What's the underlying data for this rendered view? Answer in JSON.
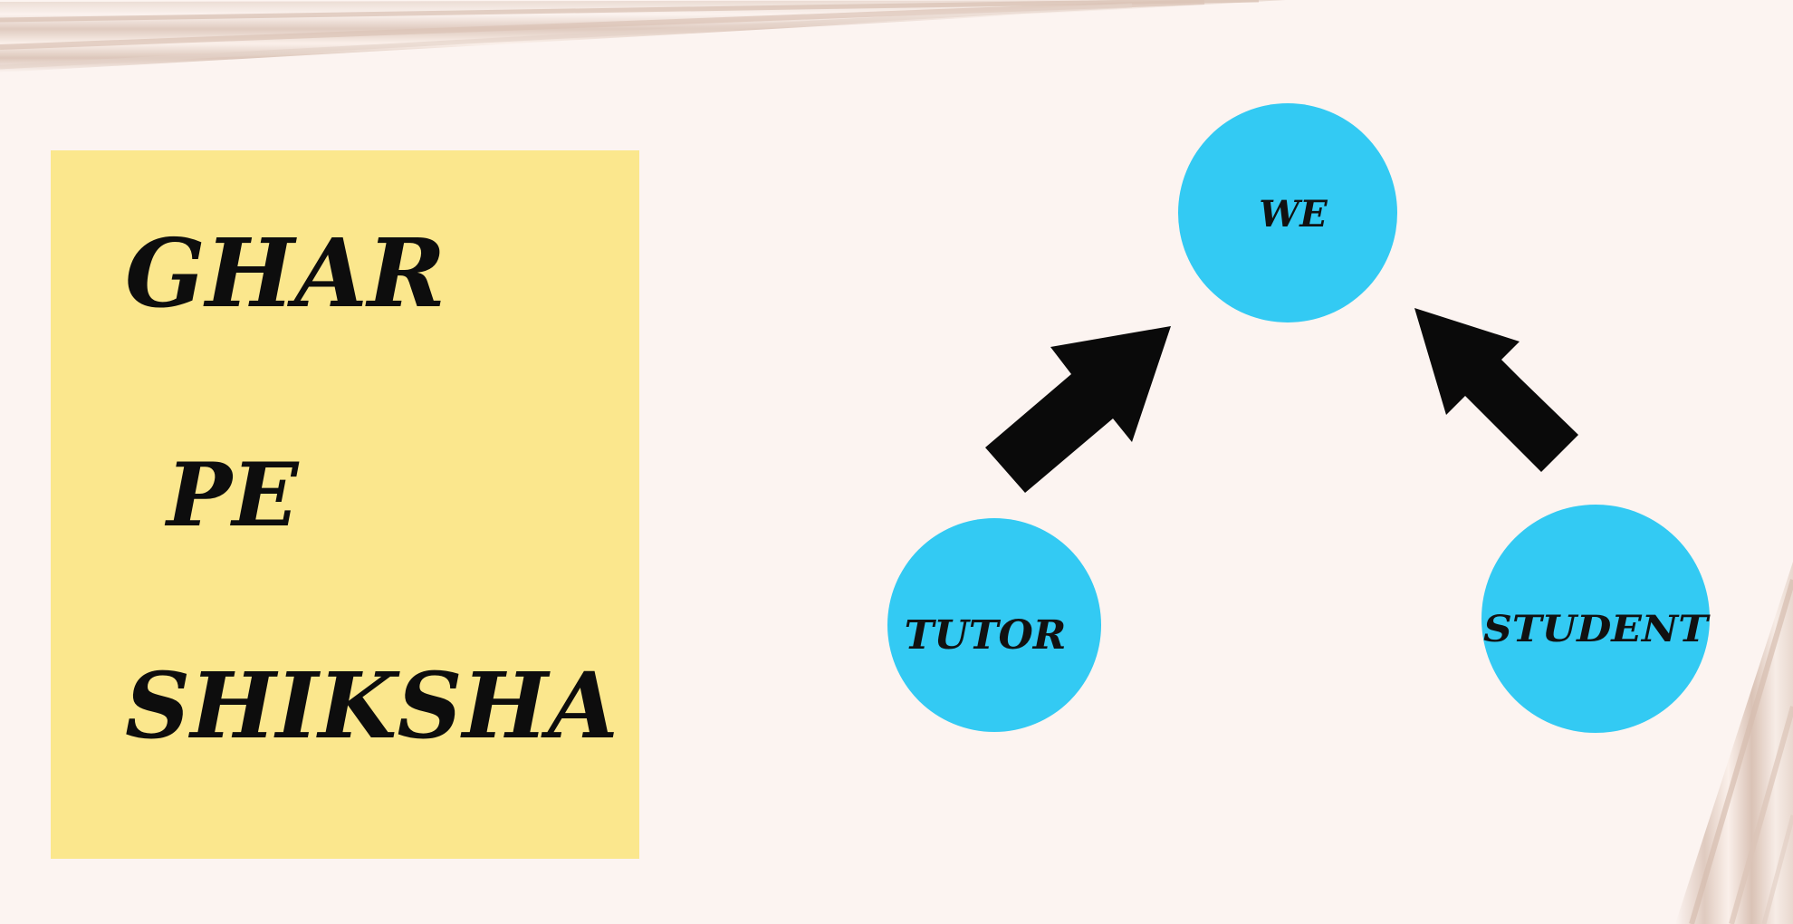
{
  "slide": {
    "note": {
      "lines": [
        "GHAR",
        "PE",
        "SHIKSHA"
      ]
    },
    "diagram": {
      "top_node": "WE",
      "left_node": "TUTOR",
      "right_node": "STUDENT"
    }
  },
  "colors": {
    "background": "#fcf4f1",
    "note_fill": "#fbe78d",
    "node_fill": "#33caf3",
    "arrow_fill": "#0a0a0a",
    "text": "#0d0d0d"
  },
  "icons": [
    "arrow-up-right-icon",
    "arrow-up-left-icon"
  ]
}
